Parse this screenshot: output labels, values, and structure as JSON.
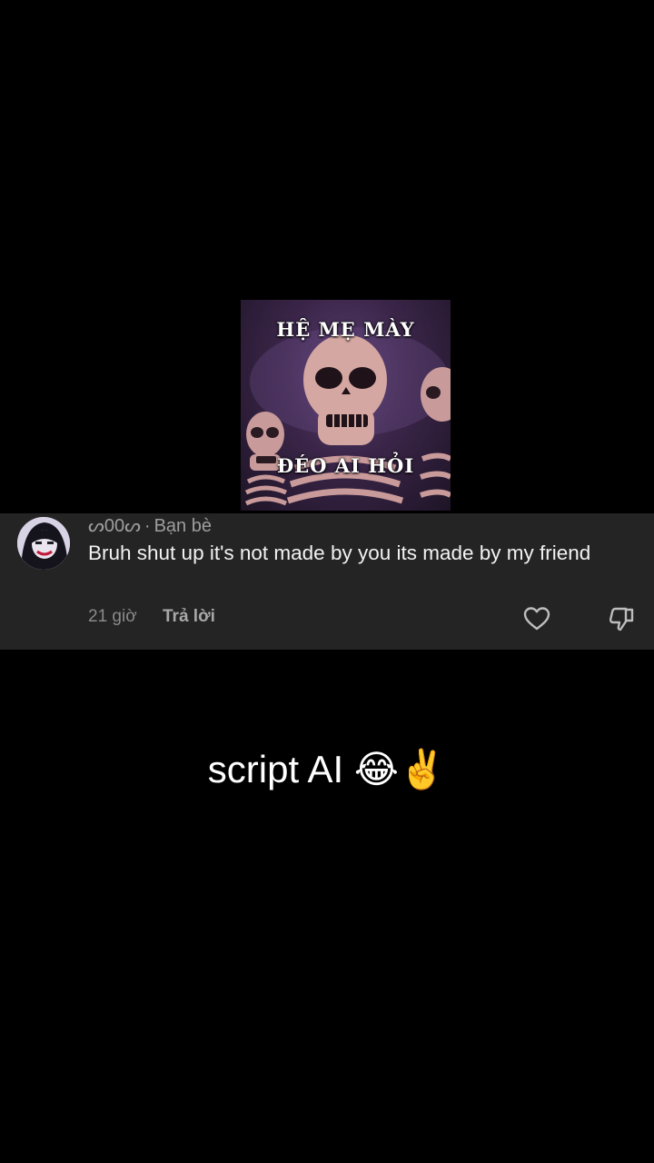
{
  "meme": {
    "top_text": "HỆ MẸ MÀY",
    "bottom_text": "ĐÉO AI HỎI"
  },
  "comment": {
    "username": "ᔕ00ᔕ",
    "relation": "Bạn bè",
    "separator": "·",
    "text": "Bruh shut up it's not made by you its made by my friend",
    "time": "21 giờ",
    "reply_label": "Trả lời",
    "icons": {
      "like": "heart-icon",
      "dislike": "thumbs-down-icon"
    }
  },
  "caption": {
    "text": "script AI 😂✌️"
  },
  "colors": {
    "background": "#000000",
    "comment_bg": "#242424",
    "muted_text": "#9e9e9e",
    "primary_text": "#f2f2f2"
  }
}
